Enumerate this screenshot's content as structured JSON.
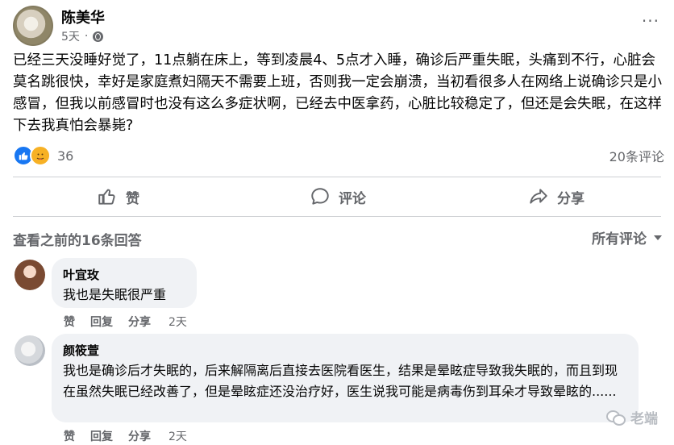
{
  "post": {
    "author": "陈美华",
    "time": "5天",
    "audience_icon": "globe-icon",
    "text": "已经三天没睡好觉了，11点躺在床上，等到凌晨4、5点才入睡，确诊后严重失眠，头痛到不行，心脏会莫名跳很快，幸好是家庭煮妇隔天不需要上班，否则我一定会崩溃，当初看很多人在网络上说确诊只是小感冒，但我以前感冒时也没有这么多症状啊，已经去中医拿药，心脏比较稳定了，但还是会失眠，在这样下去我真怕会暴毙?",
    "reaction_count": "36",
    "comments_count": "20条评论"
  },
  "actions": {
    "like": "赞",
    "comment": "评论",
    "share": "分享"
  },
  "comments_section": {
    "view_previous": "查看之前的16条回答",
    "sort_label": "所有评论"
  },
  "comments": [
    {
      "name": "叶宜玫",
      "text": "我也是失眠很严重",
      "like": "赞",
      "reply": "回复",
      "share": "分享",
      "time": "2天"
    },
    {
      "name": "颜筱萱",
      "text": "我也是确诊后才失眠的，后来解隔离后直接去医院看医生，结果是晕眩症导致我失眠的，而且到现在虽然失眠已经改善了，但是晕眩症还没治疗好，医生说我可能是病毒伤到耳朵才导致晕眩的......",
      "like": "赞",
      "reply": "回复",
      "share": "分享",
      "time": "2天"
    }
  ],
  "watermark": "老端",
  "colors": {
    "text": "#050505",
    "secondary": "#65676b",
    "bubble": "#f0f2f5",
    "like_blue": "#1877f2",
    "divider": "#ced0d4"
  }
}
